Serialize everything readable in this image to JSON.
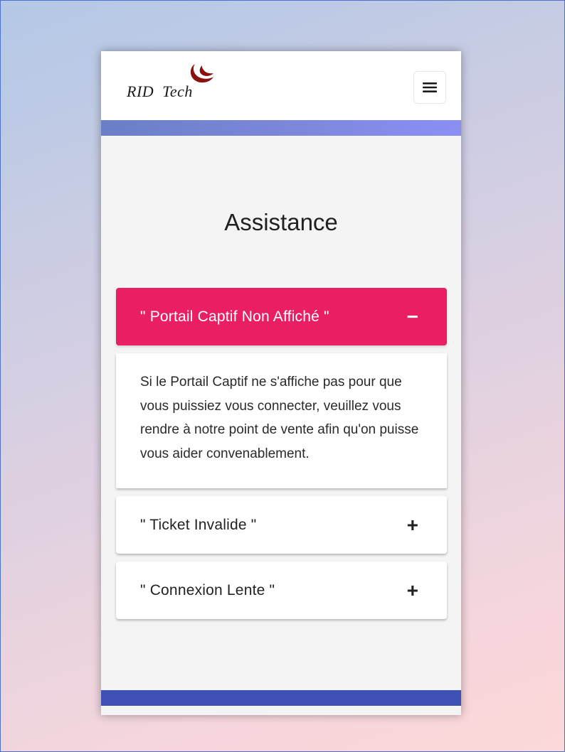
{
  "header": {
    "logo_text": "RID  Tech",
    "menu_icon": "hamburger-menu-icon"
  },
  "page": {
    "title": "Assistance"
  },
  "accordion": [
    {
      "title": "\" Portail Captif Non Affiché \"",
      "expanded": true,
      "icon": "−",
      "body": "Si le Portail Captif ne s'affiche pas pour que vous puissiez vous connecter, veuillez vous rendre à notre point de vente afin qu'on puisse vous aider convenablement."
    },
    {
      "title": "\" Ticket Invalide \"",
      "expanded": false,
      "icon": "+"
    },
    {
      "title": "\" Connexion Lente \"",
      "expanded": false,
      "icon": "+"
    }
  ],
  "colors": {
    "accent": "#e91e63",
    "header_strip": "#7b87d8",
    "footer_strip": "#3f51b5",
    "logo_mark": "#8b1010"
  }
}
